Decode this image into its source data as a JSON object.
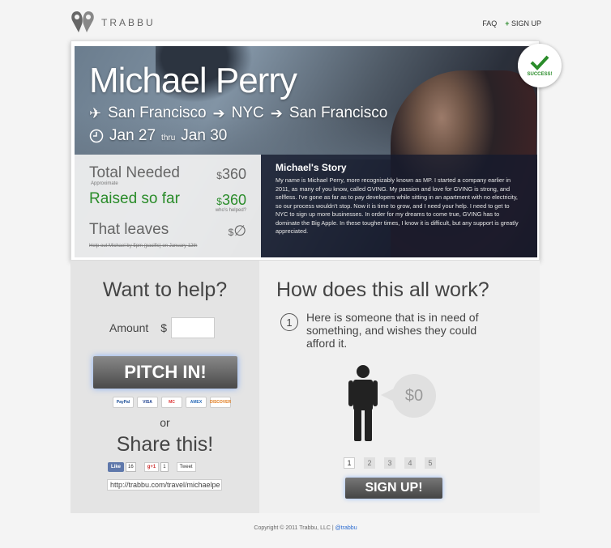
{
  "header": {
    "logo_text": "TRABBU",
    "nav": {
      "faq": "FAQ",
      "signup_plus": "+",
      "signup": "SIGN UP"
    }
  },
  "hero": {
    "name": "Michael Perry",
    "route": [
      "San Francisco",
      "NYC",
      "San Francisco"
    ],
    "date_start": "Jan 27",
    "date_thru": "thru",
    "date_end": "Jan 30",
    "badge": "SUCCESS!"
  },
  "stats": {
    "total_label": "Total Needed",
    "total_sub": "Approximate",
    "total_dollar": "$",
    "total_value": "360",
    "raised_label": "Raised so far",
    "raised_dollar": "$",
    "raised_value": "360",
    "raised_sub": "who's helped?",
    "leaves_label": "That leaves",
    "leaves_dollar": "$",
    "leaves_value": "∅",
    "note": "Help out Michael by 5pm (pacific) on January 12th"
  },
  "story": {
    "title": "Michael's Story",
    "body": "My name is Michael Perry, more recognizably known as MP. I started a company earlier in 2011, as many of you know, called GVING. My passion and love for GVING is strong, and selfless. I've gone as far as to pay developers while sitting in an apartment with no electricity, so our process wouldn't stop. Now it is time to grow, and I need your help. I need to get to NYC to sign up more businesses. In order for my dreams to come true, GVING has to dominate the Big Apple. In these tougher times, I know it is difficult, but any support is greatly appreciated."
  },
  "help": {
    "title": "Want to help?",
    "amount_label": "Amount",
    "amount_currency": "$",
    "amount_value": "",
    "pitch_button": "PITCH IN!",
    "cards": [
      "PayPal",
      "VISA",
      "MC",
      "AMEX",
      "DISCOVER"
    ],
    "or": "or",
    "share_title": "Share this!",
    "fb_like": "Like",
    "fb_count": "16",
    "gplus": "g+1",
    "gplus_count": "1",
    "tweet": "Tweet",
    "share_url": "http://trabbu.com/travel/michaelpe"
  },
  "how": {
    "title": "How does this all work?",
    "step_number": "1",
    "step_text": "Here is someone that is in need of something, and wishes they could afford it.",
    "bubble": "$0",
    "pages": [
      "1",
      "2",
      "3",
      "4",
      "5"
    ],
    "signup_button": "SIGN UP!"
  },
  "footer": {
    "copyright": "Copyright © 2011 Trabbu, LLC  |",
    "twitter": "@trabbu"
  },
  "colors": {
    "green": "#2a8c2a",
    "link": "#2a6bd1",
    "story_bg": "#141a2d"
  }
}
